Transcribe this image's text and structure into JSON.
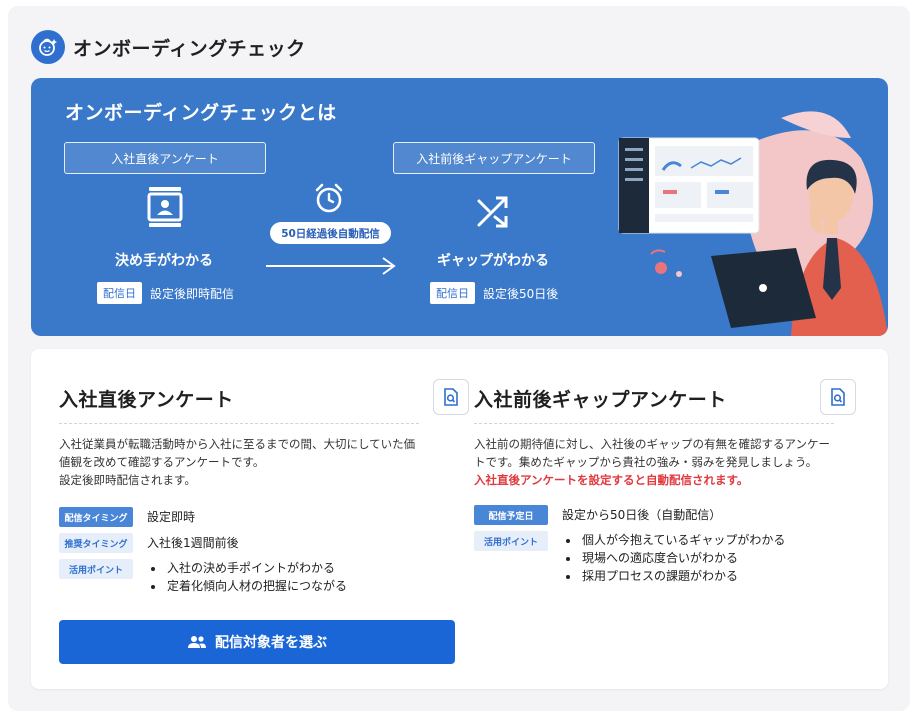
{
  "page": {
    "title": "オンボーディングチェック"
  },
  "hero": {
    "title": "オンボーディングチェックとは",
    "stage1": {
      "box": "入社直後アンケート",
      "label": "決め手がわかる",
      "tag": "配信日",
      "delivery": "設定後即時配信"
    },
    "timer_pill": "50日経過後自動配信",
    "stage2": {
      "box": "入社前後ギャップアンケート",
      "label": "ギャップがわかる",
      "tag": "配信日",
      "delivery": "設定後50日後"
    }
  },
  "left": {
    "title": "入社直後アンケート",
    "desc_lines": [
      "入社従業員が転職活動時から入社に至るまでの間、大切にしていた価",
      "値観を改めて確認するアンケートです。",
      "設定後即時配信されます。"
    ],
    "rows": [
      {
        "label": "配信タイミング",
        "value": "設定即時"
      },
      {
        "label": "推奨タイミング",
        "value": "入社後1週間前後"
      },
      {
        "label": "活用ポイント",
        "items": [
          "入社の決め手ポイントがわかる",
          "定着化傾向人材の把握につながる"
        ]
      }
    ],
    "cta": "配信対象者を選ぶ"
  },
  "right": {
    "title": "入社前後ギャップアンケート",
    "desc_lines": [
      "入社前の期待値に対し、入社後のギャップの有無を確認するアンケー",
      "トです。集めたギャップから貴社の強み・弱みを発見しましょう。"
    ],
    "desc_red": "入社直後アンケートを設定すると自動配信されます。",
    "rows": [
      {
        "label": "配信予定日",
        "value": "設定から50日後（自動配信）"
      },
      {
        "label": "活用ポイント",
        "items": [
          "個人が今抱えているギャップがわかる",
          "現場への適応度合いがわかる",
          "採用プロセスの課題がわかる"
        ]
      }
    ]
  },
  "colors": {
    "primary": "#1a66d6",
    "hero_bg": "#3a78c9",
    "accent_red": "#e0393e"
  }
}
